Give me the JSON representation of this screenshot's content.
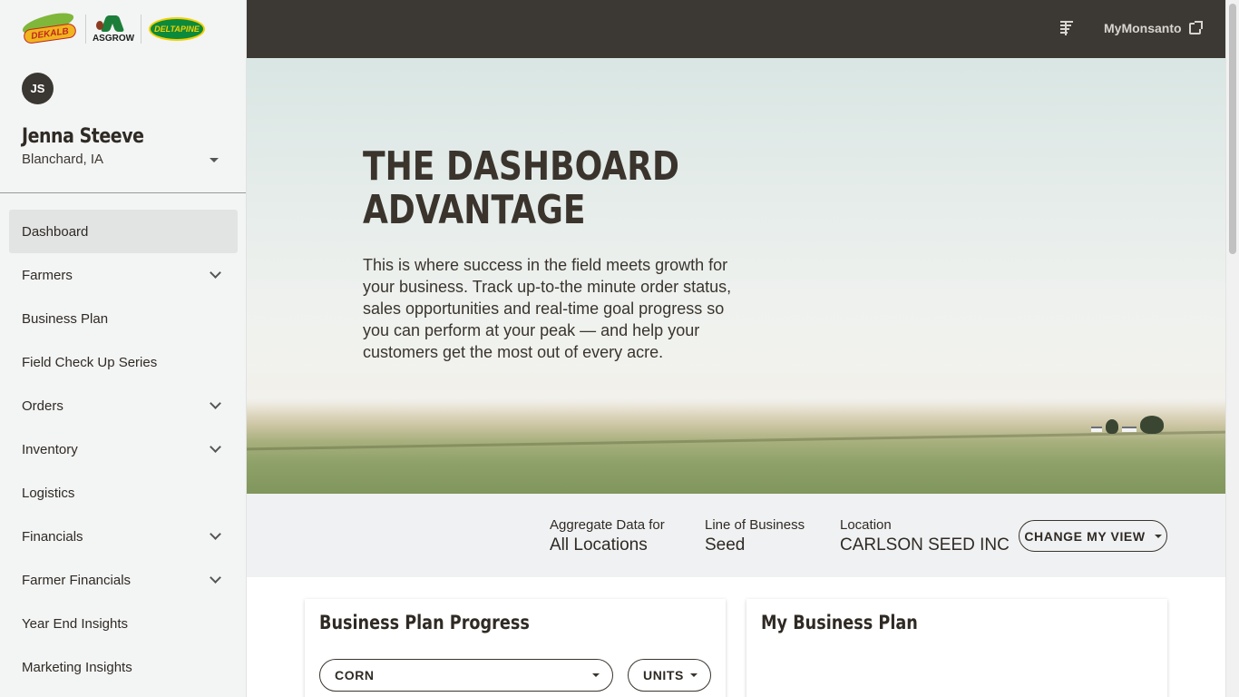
{
  "brand": {
    "logos": [
      {
        "name": "DEKALB",
        "label": "DEKALB"
      },
      {
        "name": "ASGROW",
        "label": "ASGROW"
      },
      {
        "name": "DELTAPINE",
        "label": "DELTAPINE"
      }
    ]
  },
  "user": {
    "initials": "JS",
    "name": "Jenna Steeve",
    "location": "Blanchard, IA"
  },
  "sidebar": {
    "items": [
      {
        "label": "Dashboard",
        "active": true,
        "expandable": false
      },
      {
        "label": "Farmers",
        "active": false,
        "expandable": true
      },
      {
        "label": "Business Plan",
        "active": false,
        "expandable": false
      },
      {
        "label": "Field Check Up Series",
        "active": false,
        "expandable": false
      },
      {
        "label": "Orders",
        "active": false,
        "expandable": true
      },
      {
        "label": "Inventory",
        "active": false,
        "expandable": true
      },
      {
        "label": "Logistics",
        "active": false,
        "expandable": false
      },
      {
        "label": "Financials",
        "active": false,
        "expandable": true
      },
      {
        "label": "Farmer Financials",
        "active": false,
        "expandable": true
      },
      {
        "label": "Year End Insights",
        "active": false,
        "expandable": false
      },
      {
        "label": "Marketing Insights",
        "active": false,
        "expandable": false
      }
    ]
  },
  "topbar": {
    "icon": "menu-logo-icon",
    "link_label": "MyMonsanto",
    "link_icon": "external-link-icon"
  },
  "hero": {
    "title_line1": "THE DASHBOARD",
    "title_line2": "ADVANTAGE",
    "body": "This is where success in the field meets growth for your business. Track up-to-the minute order status, sales opportunities and real-time goal progress so you can perform at your peak — and help your customers get the most out of every acre."
  },
  "filters": {
    "aggregate": {
      "label": "Aggregate Data for",
      "value": "All Locations"
    },
    "line_of_business": {
      "label": "Line of Business",
      "value": "Seed"
    },
    "location": {
      "label": "Location",
      "value": "CARLSON SEED INC"
    },
    "change_view_label": "CHANGE MY VIEW"
  },
  "cards": {
    "progress": {
      "title": "Business Plan Progress",
      "crop_select": "CORN",
      "unit_select": "UNITS"
    },
    "plan": {
      "title": "My Business Plan"
    }
  },
  "colors": {
    "topbar_bg": "#3c3833",
    "sidebar_bg": "#f3f4f4",
    "text_dark": "#2f2a24",
    "filterbar_bg": "#f0f1f2"
  }
}
